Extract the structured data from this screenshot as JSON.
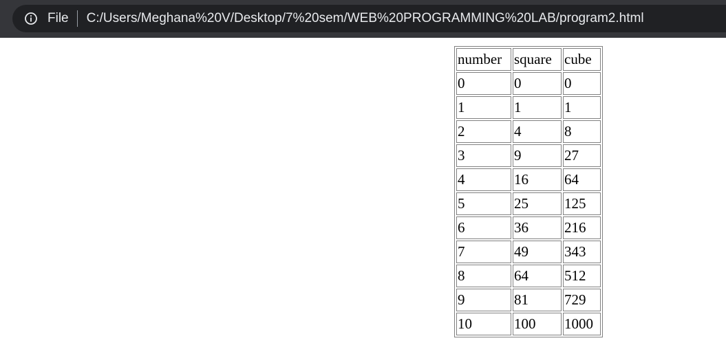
{
  "address_bar": {
    "info_icon": "info-circle-icon",
    "scheme_label": "File",
    "url": "C:/Users/Meghana%20V/Desktop/7%20sem/WEB%20PROGRAMMING%20LAB/program2.html"
  },
  "table": {
    "headers": [
      "number",
      "square",
      "cube"
    ],
    "rows": [
      [
        "0",
        "0",
        "0"
      ],
      [
        "1",
        "1",
        "1"
      ],
      [
        "2",
        "4",
        "8"
      ],
      [
        "3",
        "9",
        "27"
      ],
      [
        "4",
        "16",
        "64"
      ],
      [
        "5",
        "25",
        "125"
      ],
      [
        "6",
        "36",
        "216"
      ],
      [
        "7",
        "49",
        "343"
      ],
      [
        "8",
        "64",
        "512"
      ],
      [
        "9",
        "81",
        "729"
      ],
      [
        "10",
        "100",
        "1000"
      ]
    ]
  }
}
